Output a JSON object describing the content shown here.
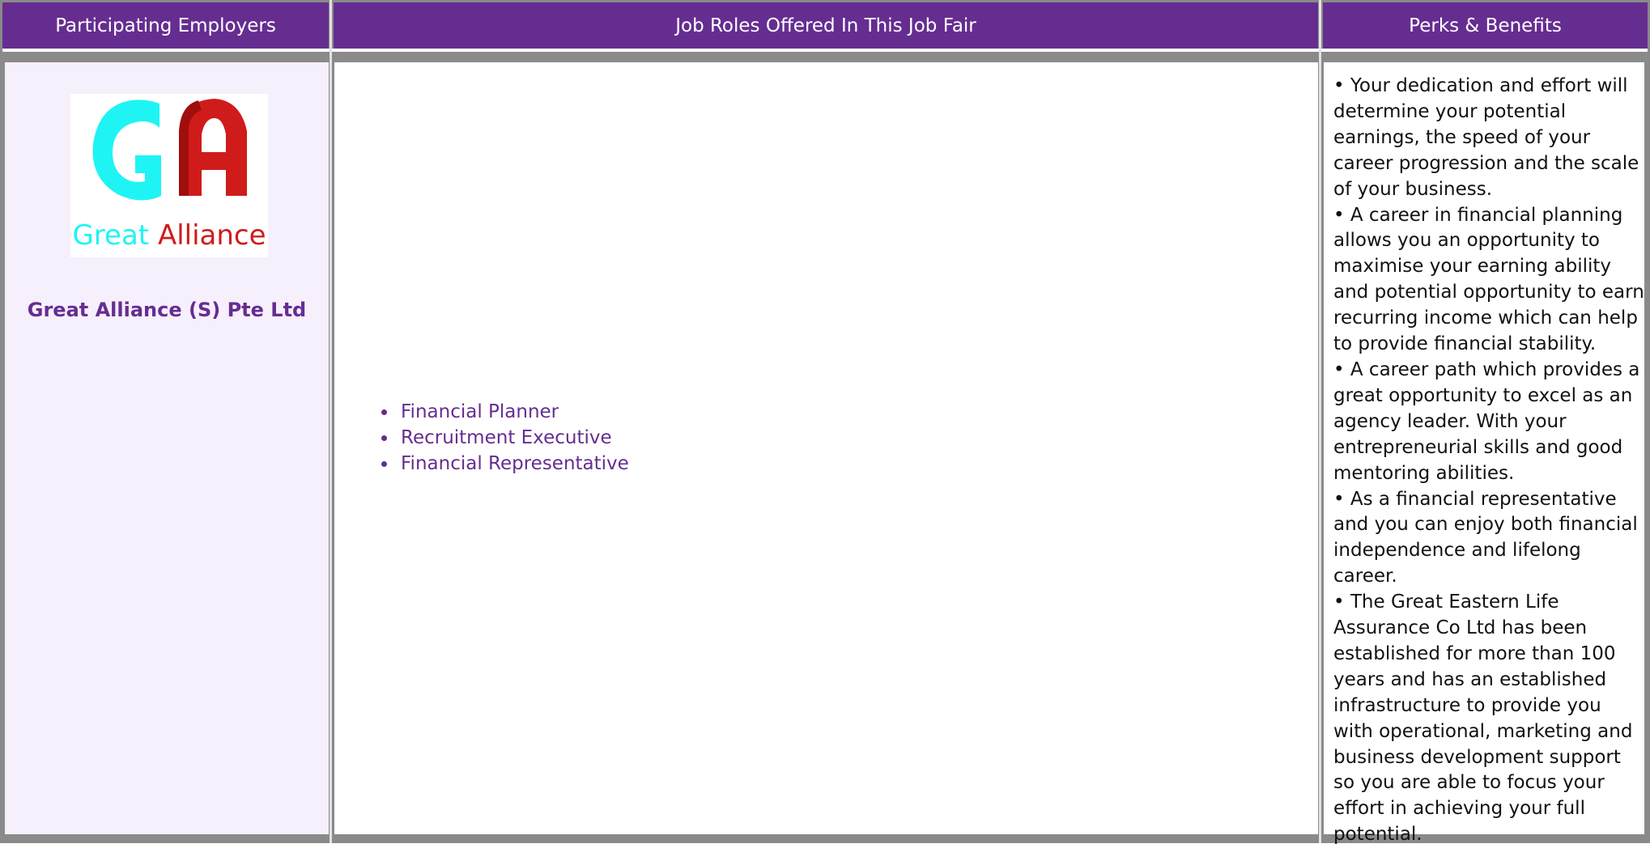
{
  "headers": {
    "employers": "Participating Employers",
    "job_roles": "Job Roles Offered In This Job Fair",
    "perks": "Perks & Benefits"
  },
  "employer": {
    "logo_text": "Great Alliance",
    "name": "Great Alliance (S) Pte Ltd",
    "logo_colors": {
      "cyan": "#1ff4f4",
      "red": "#d01b1b",
      "dark_red": "#a00e0e"
    }
  },
  "job_roles": [
    "Financial Planner",
    "Recruitment Executive",
    "Financial Representative"
  ],
  "perks": [
    "• Your dedication and effort will determine your potential earnings, the speed of your career progression and the scale of your business.",
    "• A career in financial planning allows you an opportunity to maximise your earning ability and potential opportunity to earn recurring income which can help to provide financial stability.",
    "• A career path which provides a great opportunity to excel as an agency leader. With your entrepreneurial skills and good mentoring abilities.",
    "• As a financial representative and you can enjoy both financial independence and lifelong career.",
    "• The Great Eastern Life Assurance Co Ltd has been established for more than 100 years and has an established infrastructure to provide you with operational, marketing and business development support so you are able to focus your effort in achieving your full potential."
  ],
  "colors": {
    "header_bg": "#662d91",
    "accent_text": "#662d91",
    "border": "#8a8a8a",
    "employer_cell_bg": "#f6effc"
  }
}
